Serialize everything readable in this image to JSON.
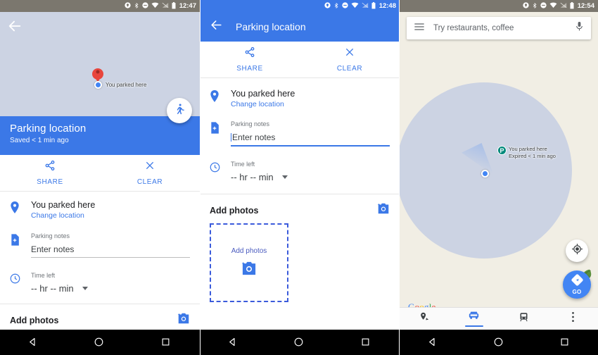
{
  "panel1": {
    "status_bar": {
      "time": "12:47",
      "icons": [
        "location-icon",
        "bluetooth-icon",
        "do-not-disturb-icon",
        "wifi-icon",
        "signal-off-icon",
        "battery-icon"
      ]
    },
    "back_icon": "back-arrow-icon",
    "map": {
      "marker_label": "You parked here",
      "pin_color": "#e8453c",
      "user_dot_color": "#4285f4",
      "circle_color": "#ccd3e3",
      "background_color": "#f1eee4"
    },
    "walk_fab_icon": "walking-person-icon",
    "header": {
      "title": "Parking location",
      "subtitle": "Saved < 1 min ago",
      "background_color": "#3b78e7"
    },
    "actions": [
      {
        "label": "SHARE",
        "icon": "share-icon"
      },
      {
        "label": "CLEAR",
        "icon": "close-icon"
      }
    ],
    "location_row": {
      "icon": "place-pin-icon",
      "title": "You parked here",
      "link": "Change location"
    },
    "notes_row": {
      "icon": "note-add-icon",
      "label": "Parking notes",
      "placeholder": "Enter notes",
      "value": ""
    },
    "time_row": {
      "icon": "clock-icon",
      "label": "Time left",
      "value": "-- hr -- min"
    },
    "photos": {
      "title": "Add photos",
      "camera_icon": "add-photo-camera-icon"
    }
  },
  "panel2": {
    "status_bar": {
      "time": "12:48"
    },
    "app_bar": {
      "back_icon": "back-arrow-icon",
      "title": "Parking location",
      "background_color": "#3b78e7"
    },
    "actions": [
      {
        "label": "SHARE",
        "icon": "share-icon"
      },
      {
        "label": "CLEAR",
        "icon": "close-icon"
      }
    ],
    "location_row": {
      "icon": "place-pin-icon",
      "title": "You parked here",
      "link": "Change location"
    },
    "notes_row": {
      "icon": "note-add-icon",
      "label": "Parking notes",
      "placeholder": "Enter notes",
      "value": "",
      "focused": true
    },
    "time_row": {
      "icon": "clock-icon",
      "label": "Time left",
      "value": "-- hr -- min"
    },
    "photos": {
      "title": "Add photos",
      "camera_icon": "add-photo-camera-icon",
      "dropzone_label": "Add photos",
      "dropzone_icon": "add-photo-camera-icon",
      "dropzone_border_color": "#3b5bdb"
    }
  },
  "panel3": {
    "status_bar": {
      "time": "12:54"
    },
    "search": {
      "menu_icon": "hamburger-menu-icon",
      "placeholder": "Try restaurants, coffee",
      "mic_icon": "microphone-icon"
    },
    "map": {
      "parking_badge": "P",
      "parking_badge_color": "#00897b",
      "marker_line1": "You parked here",
      "marker_line2": "Expired < 1 min ago",
      "user_dot_color": "#4285f4",
      "circle_color": "#ccd3e3",
      "background_color": "#f1eee4"
    },
    "my_location_icon": "my-location-icon",
    "go_button": {
      "label": "GO",
      "icon": "navigation-arrow-icon",
      "color": "#4285f4"
    },
    "watermark": {
      "letters": [
        "G",
        "o",
        "o",
        "g",
        "l",
        "e"
      ]
    },
    "bottom_nav": [
      {
        "name": "explore",
        "icon": "explore-pin-icon",
        "selected": false
      },
      {
        "name": "driving",
        "icon": "car-icon",
        "selected": true
      },
      {
        "name": "transit",
        "icon": "transit-icon",
        "selected": false
      },
      {
        "name": "more",
        "icon": "overflow-menu-icon",
        "selected": false
      }
    ]
  },
  "android_nav": {
    "back_icon": "nav-back-triangle-icon",
    "home_icon": "nav-home-circle-icon",
    "recents_icon": "nav-recents-square-icon"
  }
}
